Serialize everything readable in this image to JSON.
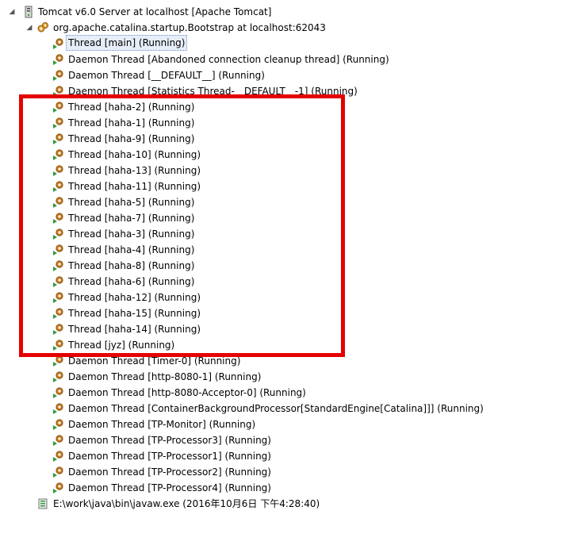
{
  "debug_tree": {
    "server": {
      "label": "Tomcat v6.0 Server at localhost [Apache Tomcat]",
      "icon": "server-icon"
    },
    "process": {
      "label": "org.apache.catalina.startup.Bootstrap at localhost:62043",
      "icon": "process-icon"
    },
    "threads": [
      {
        "label": "Thread [main] (Running)",
        "selected": true
      },
      {
        "label": "Daemon Thread [Abandoned connection cleanup thread] (Running)"
      },
      {
        "label": "Daemon Thread [__DEFAULT__] (Running)"
      },
      {
        "label": "Daemon Thread [Statistics Thread-__DEFAULT__-1] (Running)"
      },
      {
        "label": "Thread [haha-2] (Running)"
      },
      {
        "label": "Thread [haha-1] (Running)"
      },
      {
        "label": "Thread [haha-9] (Running)"
      },
      {
        "label": "Thread [haha-10] (Running)"
      },
      {
        "label": "Thread [haha-13] (Running)"
      },
      {
        "label": "Thread [haha-11] (Running)"
      },
      {
        "label": "Thread [haha-5] (Running)"
      },
      {
        "label": "Thread [haha-7] (Running)"
      },
      {
        "label": "Thread [haha-3] (Running)"
      },
      {
        "label": "Thread [haha-4] (Running)"
      },
      {
        "label": "Thread [haha-8] (Running)"
      },
      {
        "label": "Thread [haha-6] (Running)"
      },
      {
        "label": "Thread [haha-12] (Running)"
      },
      {
        "label": "Thread [haha-15] (Running)"
      },
      {
        "label": "Thread [haha-14] (Running)"
      },
      {
        "label": "Thread [jyz] (Running)"
      },
      {
        "label": "Daemon Thread [Timer-0] (Running)"
      },
      {
        "label": "Daemon Thread [http-8080-1] (Running)"
      },
      {
        "label": "Daemon Thread [http-8080-Acceptor-0] (Running)"
      },
      {
        "label": "Daemon Thread [ContainerBackgroundProcessor[StandardEngine[Catalina]]] (Running)"
      },
      {
        "label": "Daemon Thread [TP-Monitor] (Running)"
      },
      {
        "label": "Daemon Thread [TP-Processor3] (Running)"
      },
      {
        "label": "Daemon Thread [TP-Processor1] (Running)"
      },
      {
        "label": "Daemon Thread [TP-Processor2] (Running)"
      },
      {
        "label": "Daemon Thread [TP-Processor4] (Running)"
      }
    ],
    "thread_icon": "running-thread-icon",
    "executable": {
      "label": "E:\\work\\java\\bin\\javaw.exe (2016年10月6日 下午4:28:40)",
      "icon": "executable-icon"
    }
  },
  "annotation": {
    "type": "highlight-rectangle",
    "color": "#e50000"
  },
  "colors": {
    "thread_gear": "#c87a1c",
    "thread_arrow": "#2e9b3a",
    "selection_bg": "#e7eef9"
  }
}
